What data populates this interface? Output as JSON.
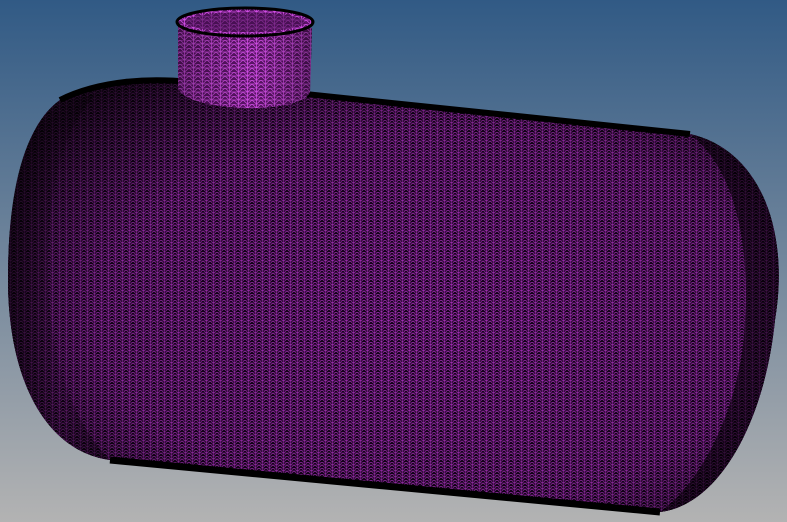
{
  "viewport": {
    "background_top": "#315a85",
    "background_bottom": "#b3b3b3",
    "mesh_color": "#b032c4",
    "mesh_shadow": "#1a0420",
    "edge_color": "#000000"
  },
  "model": {
    "icon": "cylindrical-tank-mesh",
    "parts": [
      "tank-body",
      "nozzle"
    ]
  }
}
